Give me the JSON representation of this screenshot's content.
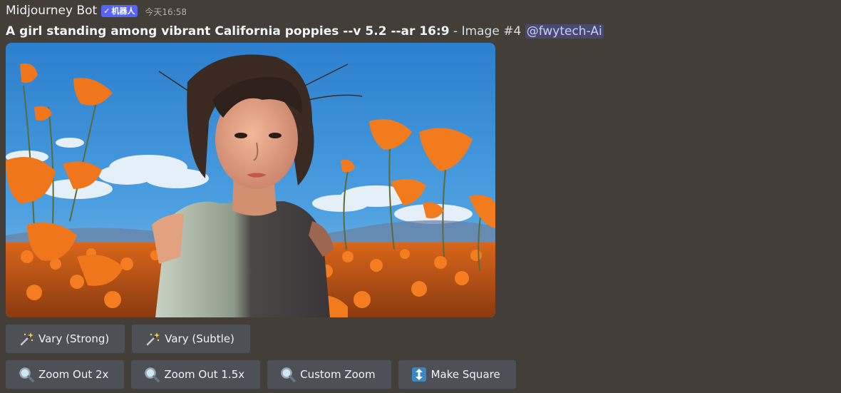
{
  "message": {
    "username": "Midjourney Bot",
    "bot_tag": {
      "check": "✓",
      "label": "机器人"
    },
    "timestamp": "今天16:58",
    "prompt": "A girl standing among vibrant California poppies --v 5.2 --ar 16:9",
    "suffix": " - Image #4 ",
    "mention": "@fwytech-Ai"
  },
  "image": {
    "subject": "girl-in-poppy-field",
    "colors": {
      "sky": "#3a8ed6",
      "poppy": "#f07a1e",
      "skin": "#e8a887",
      "hair": "#3a2a22"
    }
  },
  "buttons_row1": [
    {
      "label": "Vary (Strong)",
      "icon": "magic-wand-icon"
    },
    {
      "label": "Vary (Subtle)",
      "icon": "magic-wand-icon"
    }
  ],
  "buttons_row2": [
    {
      "label": "Zoom Out 2x",
      "icon": "magnifier-icon"
    },
    {
      "label": "Zoom Out 1.5x",
      "icon": "magnifier-icon"
    },
    {
      "label": "Custom Zoom",
      "icon": "magnifier-icon"
    },
    {
      "label": "Make Square",
      "icon": "up-down-arrow-icon"
    }
  ],
  "colors": {
    "background": "#433e37",
    "button": "#4e5058",
    "blurple": "#5865f2"
  }
}
